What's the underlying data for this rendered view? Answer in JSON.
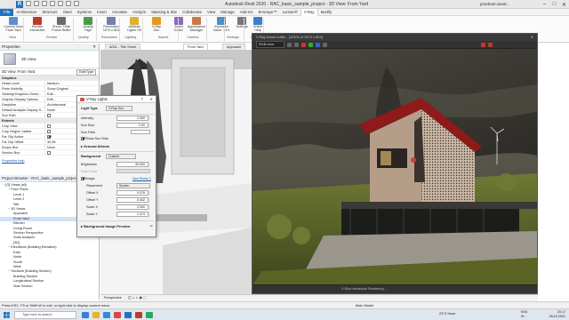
{
  "app": {
    "title": "Autodesk Revit 2020 - RAC_basic_sample_project - 3D View: From Yard",
    "user": "prashant.sanal…",
    "search_placeholder": "Type a keyword or phrase"
  },
  "menu": {
    "file": "File",
    "tabs": [
      "Architecture",
      "Structure",
      "Steel",
      "Systems",
      "Insert",
      "Annotate",
      "Analyze",
      "Massing & Site",
      "Collaborate",
      "View",
      "Manage",
      "Add-Ins",
      "Enscape™",
      "Lumion®",
      "V-Ray",
      "Modify"
    ],
    "active_index": 14
  },
  "ribbon": {
    "buttons": [
      {
        "label": "Current View\nFrom Yard",
        "icon": "camera-icon"
      },
      {
        "label": "Render\nInteractive",
        "icon": "teapot-icon"
      },
      {
        "label": "Show / Hide\nFrame Buffer",
        "icon": "frame-buffer-icon"
      },
      {
        "label": "Quality\nHigh",
        "icon": "quality-icon"
      },
      {
        "label": "Resolution\n1074 x 824",
        "icon": "resolution-icon"
      },
      {
        "label": "Artificial\nLights Off",
        "icon": "bulb-icon"
      },
      {
        "label": "V-Ray\nSun",
        "icon": "sun-icon"
      },
      {
        "label": "Asset\nEditor",
        "icon": "asset-editor-icon"
      },
      {
        "label": "Appearance\nManager",
        "icon": "appearance-icon"
      },
      {
        "label": "Exposure\nValue: 14.0",
        "icon": "exposure-icon"
      },
      {
        "label": "Settings",
        "icon": "gear-icon"
      },
      {
        "label": "Online\nHelp",
        "icon": "help-icon"
      }
    ],
    "groups": [
      "View",
      "Render",
      "Quality",
      "Resolution",
      "Lighting",
      "Assets",
      "Camera",
      "Settings",
      "Help"
    ]
  },
  "properties": {
    "panel_title": "Properties",
    "type_name": "3D View",
    "instance_label": "3D View: From Yard",
    "edit_type": "Edit Type",
    "rows": [
      {
        "k": "Graphics",
        "v": "",
        "section": true
      },
      {
        "k": "Detail Level",
        "v": "Medium"
      },
      {
        "k": "Parts Visibility",
        "v": "Show Original"
      },
      {
        "k": "Visibility/Graphics Overri...",
        "v": "Edit..."
      },
      {
        "k": "Graphic Display Options",
        "v": "Edit..."
      },
      {
        "k": "Discipline",
        "v": "Architectural"
      },
      {
        "k": "Default Analysis Display S...",
        "v": "None"
      },
      {
        "k": "Sun Path",
        "v": "cb0"
      },
      {
        "k": "Extents",
        "v": "",
        "section": true
      },
      {
        "k": "Crop View",
        "v": "cb0"
      },
      {
        "k": "Crop Region Visible",
        "v": "cb0"
      },
      {
        "k": "Far Clip Active",
        "v": "cb1"
      },
      {
        "k": "Far Clip Offset",
        "v": "30.48"
      },
      {
        "k": "Scope Box",
        "v": "None"
      },
      {
        "k": "Section Box",
        "v": "cb0"
      }
    ],
    "help_link": "Properties help",
    "apply": "Apply"
  },
  "browser": {
    "title": "Project Browser - RAC_basic_sample_project",
    "items": [
      {
        "t": "[O] Views (all)",
        "d": 0
      },
      {
        "t": "Floor Plans",
        "d": 1
      },
      {
        "t": "Level 1",
        "d": 2
      },
      {
        "t": "Level 2",
        "d": 2
      },
      {
        "t": "Site",
        "d": 2
      },
      {
        "t": "3D Views",
        "d": 1
      },
      {
        "t": "Approach",
        "d": 2
      },
      {
        "t": "From Yard",
        "d": 2,
        "sel": true
      },
      {
        "t": "Kitchen",
        "d": 2
      },
      {
        "t": "Living Room",
        "d": 2
      },
      {
        "t": "Section Perspective",
        "d": 2
      },
      {
        "t": "Solar Analysis",
        "d": 2
      },
      {
        "t": "{3D}",
        "d": 2
      },
      {
        "t": "Elevations (Building Elevation)",
        "d": 1
      },
      {
        "t": "East",
        "d": 2
      },
      {
        "t": "North",
        "d": 2
      },
      {
        "t": "South",
        "d": 2
      },
      {
        "t": "West",
        "d": 2
      },
      {
        "t": "Sections (Building Section)",
        "d": 1
      },
      {
        "t": "Building Section",
        "d": 2
      },
      {
        "t": "Longitudinal Section",
        "d": 2
      },
      {
        "t": "Stair Section",
        "d": 2
      }
    ]
  },
  "view_tabs": [
    {
      "label": "A001 - Title Sheet",
      "active": false
    },
    {
      "label": "From Yard",
      "active": true
    },
    {
      "label": "Approach",
      "active": false
    }
  ],
  "vfb": {
    "title": "V-Ray frame buffer - [100% of 1074 x 824]",
    "channel": "RGB color",
    "status": "V-Ray Interactive Rendering..."
  },
  "lights_dialog": {
    "title": "V-Ray Lights",
    "light_type_label": "Light Type",
    "light_type_value": "V-Ray Sun",
    "intensity_label": "Intensity",
    "intensity": "1.000",
    "size_label": "Sun Size",
    "size": "2.00",
    "filter_label": "Sun Filter",
    "show_sun_disk": "Show Sun Disk",
    "ground_albedo": "Ground Albedo",
    "background_label": "Background",
    "background_value": "Custom",
    "brightness_label": "Brightness",
    "brightness": "40.000",
    "solid_color_label": "Solid Color",
    "image_label": "Image",
    "image_link": "Sea Rocks 1",
    "placement_label": "Placement",
    "placement_value": "Screen",
    "offset_x_label": "Offset X",
    "offset_x": "0.076",
    "offset_y_label": "Offset Y",
    "offset_y": "0.442",
    "scale_x_label": "Scale X",
    "scale_x": "2.000",
    "scale_y_label": "Scale Y",
    "scale_y": "1.474",
    "preview_label": "Background Image Preview"
  },
  "controls": {
    "scale": "Perspective"
  },
  "status": {
    "text": "Press ESC, F5 or Shift+W to exit, or right click to display context menu",
    "main_model": "Main Model"
  },
  "taskbar": {
    "search": "Type here to search",
    "weather": "23°C  Haze",
    "lang": "ENG\nIN",
    "time": "20:17",
    "date": "28-10-2021"
  },
  "colors": {
    "accent": "#1e73be",
    "vray_red": "#c03a2b",
    "roof": "#9b1d1d",
    "facade": "#c8a48a"
  }
}
